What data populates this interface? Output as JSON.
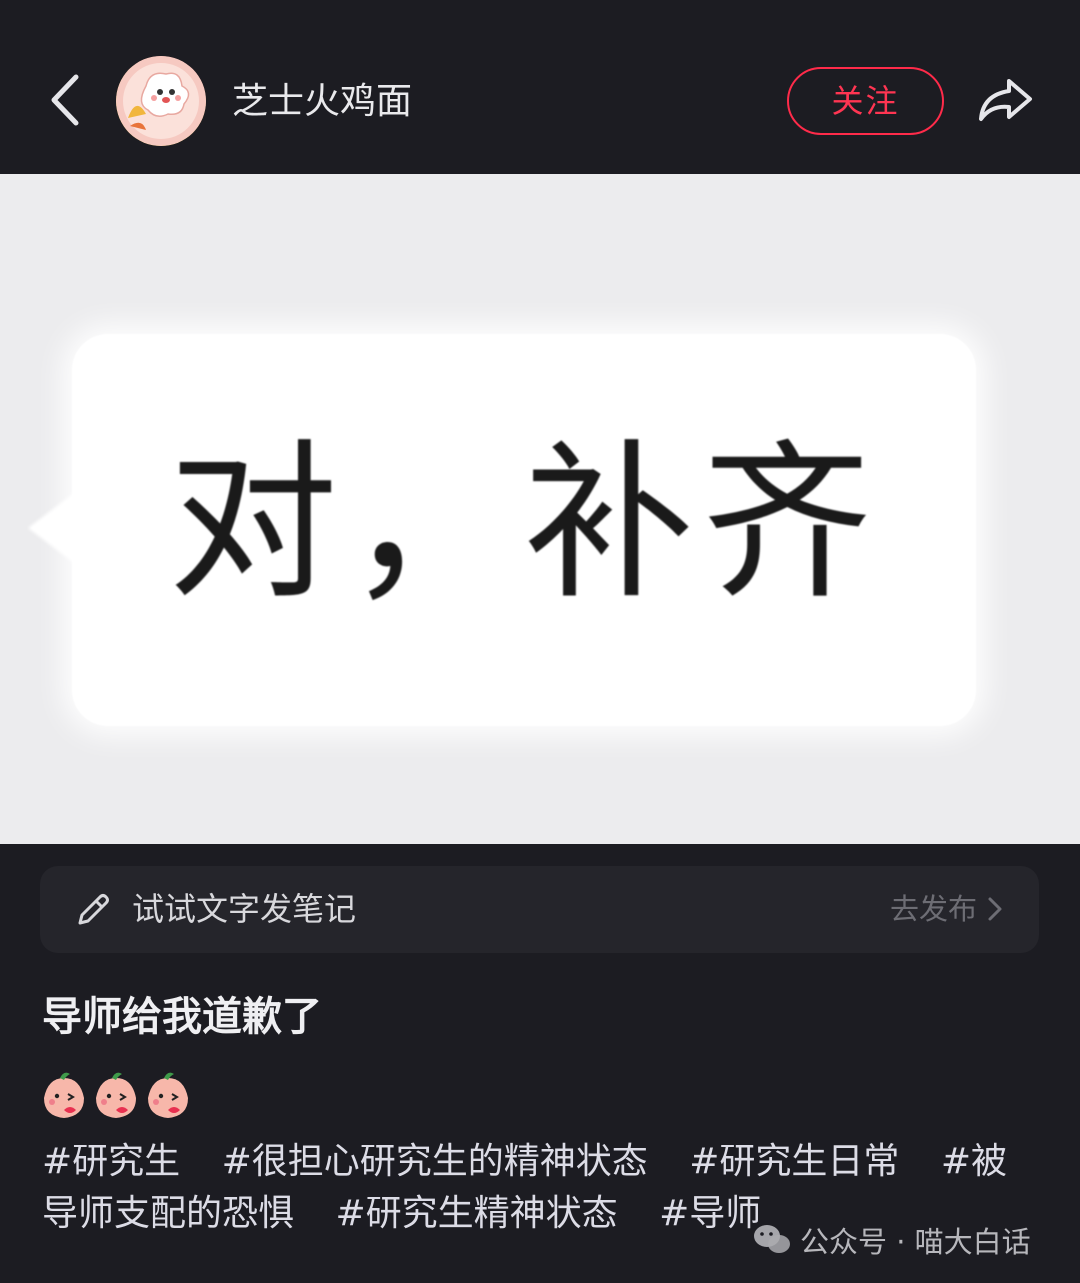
{
  "header": {
    "back_icon": "chevron-left-icon",
    "avatar_icon": "cartoon-avatar",
    "username": "芝士火鸡面",
    "follow_label": "关注",
    "follow_color": "#ff2b4a",
    "share_icon": "share-arrow-icon"
  },
  "image": {
    "bubble_text": "对，补齐"
  },
  "note_bar": {
    "icon": "pencil-icon",
    "label": "试试文字发笔记",
    "action_label": "去发布",
    "action_icon": "chevron-right-icon"
  },
  "post": {
    "title": "导师给我道歉了",
    "emojis": [
      "peach-kiss-emoji",
      "peach-kiss-emoji",
      "peach-kiss-emoji"
    ],
    "tags": [
      "#研究生",
      "#很担心研究生的精神状态",
      "#研究生日常",
      "#被导师支配的恐惧",
      "#研究生精神状态",
      "#导师"
    ]
  },
  "watermark": {
    "icon": "wechat-icon",
    "text": "公众号 · 喵大白话"
  }
}
